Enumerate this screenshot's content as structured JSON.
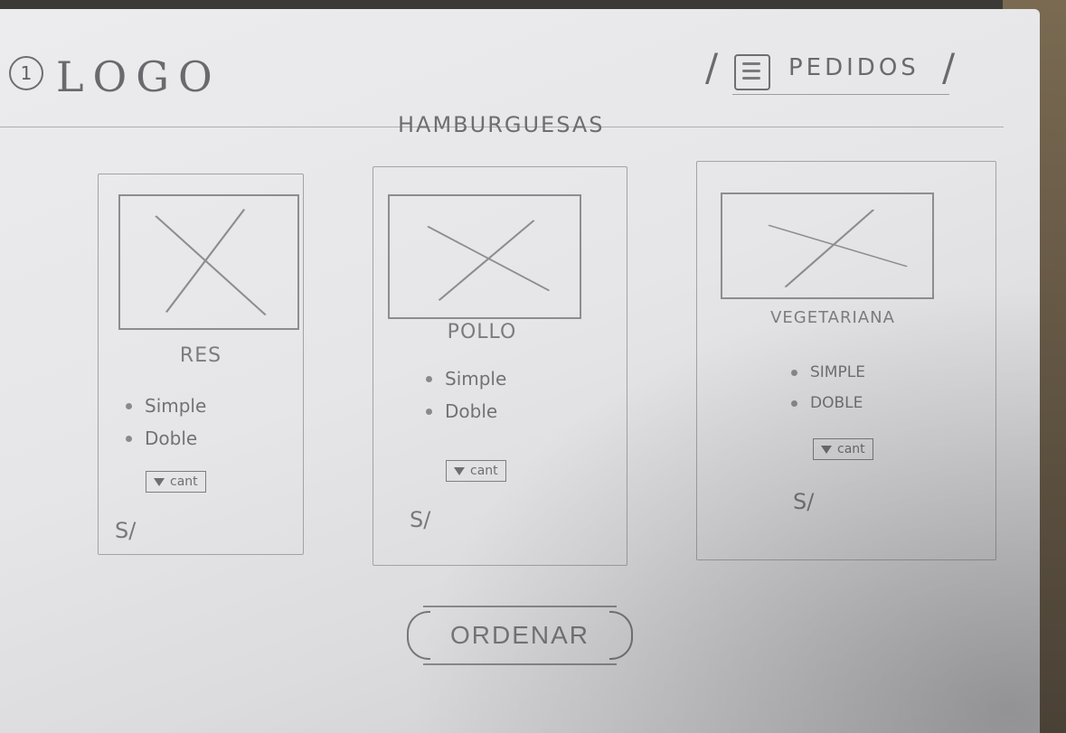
{
  "header": {
    "logo_number": "1",
    "logo_text": "LOGO",
    "orders_label": "PEDIDOS",
    "orders_icon": "burger-icon"
  },
  "section": {
    "title": "HAMBURGUESAS"
  },
  "products": [
    {
      "name": "RES",
      "options": [
        "Simple",
        "Doble"
      ],
      "qty_label": "cant",
      "price": "S/"
    },
    {
      "name": "POLLO",
      "options": [
        "Simple",
        "Doble"
      ],
      "qty_label": "cant",
      "price": "S/"
    },
    {
      "name": "VEGETARIANA",
      "options": [
        "SIMPLE",
        "DOBLE"
      ],
      "qty_label": "cant",
      "price": "S/"
    }
  ],
  "order_button": {
    "label": "ORDENAR"
  }
}
